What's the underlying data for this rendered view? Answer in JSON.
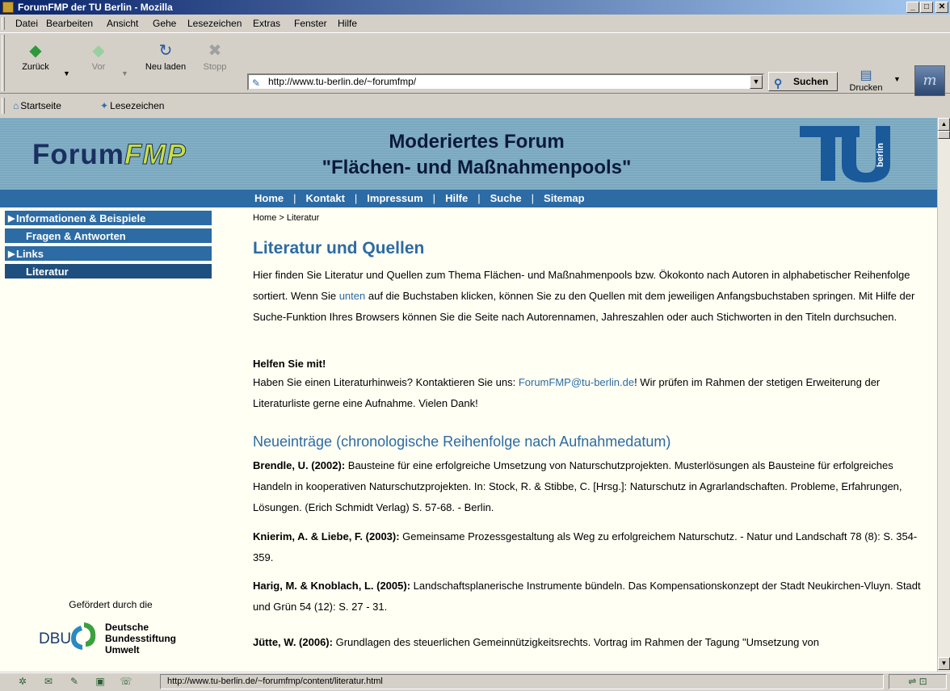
{
  "window": {
    "title": "ForumFMP der TU Berlin - Mozilla",
    "min_glyph": "_",
    "max_glyph": "□",
    "close_glyph": "✕"
  },
  "menu": [
    "Datei",
    "Bearbeiten",
    "Ansicht",
    "Gehe",
    "Lesezeichen",
    "Extras",
    "Fenster",
    "Hilfe"
  ],
  "toolbar": {
    "back": "Zurück",
    "forward": "Vor",
    "reload": "Neu laden",
    "stop": "Stopp",
    "url": "http://www.tu-berlin.de/~forumfmp/",
    "search": "Suchen",
    "print": "Drucken",
    "brand_glyph": "m"
  },
  "bookmarks": [
    "Startseite",
    "Lesezeichen"
  ],
  "site": {
    "logo_plain": "Forum",
    "logo_em": "FMP",
    "title_line1": "Moderiertes Forum",
    "title_line2": "\"Flächen- und Maßnahmenpools\"",
    "tu_logo_text": "berlin"
  },
  "topnav": [
    "Home",
    "Kontakt",
    "Impressum",
    "Hilfe",
    "Suche",
    "Sitemap"
  ],
  "sidebar": {
    "items": [
      {
        "label": "Informationen & Beispiele",
        "arrow": "▶"
      },
      {
        "label": "Fragen & Antworten",
        "arrow": ""
      },
      {
        "label": "Links",
        "arrow": "▶"
      },
      {
        "label": "Literatur",
        "arrow": ""
      }
    ],
    "sponsor_text": "Gefördert durch die",
    "dbu_abbr": "DBU",
    "dbu_name1": "Deutsche",
    "dbu_name2": "Bundesstiftung",
    "dbu_name3": "Umwelt"
  },
  "main": {
    "breadcrumb": "Home  >  Literatur",
    "heading": "Literatur und Quellen",
    "intro_1": "Hier finden Sie Literatur und Quellen zum Thema Flächen- und Maßnahmenpools bzw. Ökokonto nach Autoren in alphabetischer Reihenfolge sortiert. Wenn Sie ",
    "intro_link": "unten",
    "intro_2": " auf die Buchstaben klicken, können Sie zu den Quellen mit dem jeweiligen Anfangsbuchstaben springen. Mit Hilfe der Suche-Funktion Ihres Browsers können Sie die Seite nach Autorennamen, Jahreszahlen oder auch Stichworten in den Titeln durchsuchen.",
    "help_heading": "Helfen Sie mit!",
    "help_1": "Haben Sie einen Literaturhinweis? Kontaktieren Sie uns: ",
    "help_email": "ForumFMP@tu-berlin.de",
    "help_2": "! Wir prüfen im Rahmen der stetigen Erweiterung der Literaturliste gerne eine Aufnahme. Vielen Dank!",
    "new_heading": "Neueinträge (chronologische Reihenfolge nach Aufnahmedatum)",
    "entries": [
      {
        "author": "Brendle, U. (2002):",
        "text": " Bausteine für eine erfolgreiche Umsetzung von Naturschutzprojekten. Musterlösungen als Bausteine für erfolgreiches Handeln in kooperativen Naturschutzprojekten. In: Stock, R. & Stibbe, C. [Hrsg.]: Naturschutz in Agrarlandschaften. Probleme, Erfahrungen, Lösungen. (Erich Schmidt Verlag) S. 57-68. - Berlin."
      },
      {
        "author": "Knierim, A. & Liebe, F. (2003):",
        "text": " Gemeinsame Prozessgestaltung als Weg zu erfolgreichem Naturschutz. - Natur und Landschaft 78 (8): S. 354-359."
      },
      {
        "author": "Harig, M. & Knoblach, L. (2005):",
        "text": " Landschaftsplanerische Instrumente bündeln. Das Kompensationskonzept der Stadt Neukirchen-Vluyn. Stadt und Grün 54 (12): S. 27 - 31."
      },
      {
        "author": "Jütte, W. (2006):",
        "text": " Grundlagen des steuerlichen Gemeinnützigkeitsrechts. Vortrag im Rahmen der Tagung \"Umsetzung von"
      }
    ]
  },
  "status": {
    "url": "http://www.tu-berlin.de/~forumfmp/content/literatur.html"
  },
  "colors": {
    "accent": "#2c6ba4",
    "page_bg": "#fffff4",
    "header_bg": "#86b2c8",
    "chrome": "#d4d0c8"
  }
}
